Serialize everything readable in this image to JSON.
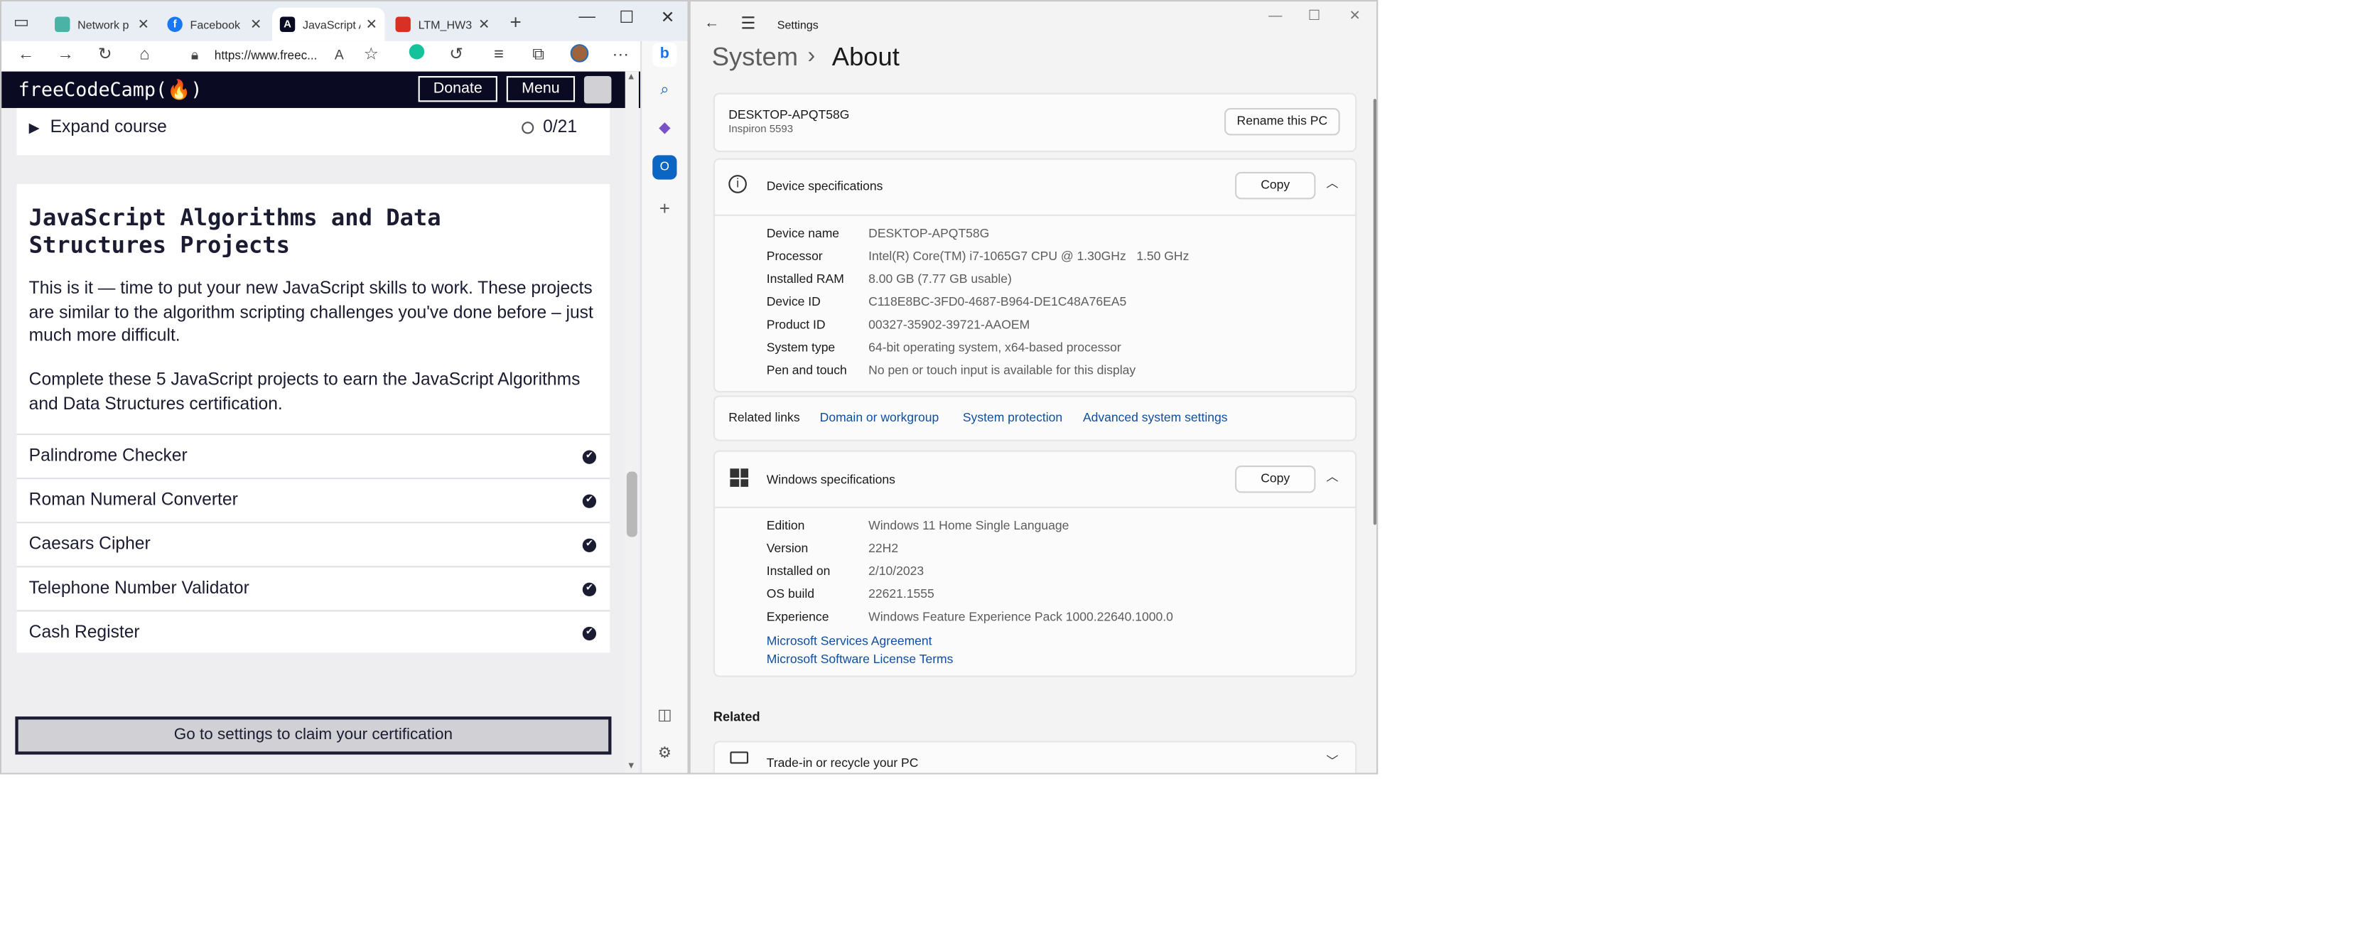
{
  "browser": {
    "tabs": [
      {
        "title": "Network p",
        "icon": "network-icon"
      },
      {
        "title": "Facebook",
        "icon": "facebook-icon"
      },
      {
        "title": "JavaScript A",
        "icon": "freecodecamp-icon"
      },
      {
        "title": "LTM_HW3",
        "icon": "pdf-icon"
      }
    ],
    "url": "https://www.freec...",
    "fcc": {
      "logo": "freeCodeCamp(🔥)",
      "donate": "Donate",
      "menu": "Menu",
      "expand_label": "Expand course",
      "expand_count": "0/21",
      "project_title": "JavaScript Algorithms and Data Structures Projects",
      "description_1": "This is it — time to put your new JavaScript skills to work. These projects are similar to the algorithm scripting challenges you've done before – just much more difficult.",
      "description_2": "Complete these 5 JavaScript projects to earn the JavaScript Algorithms and Data Structures certification.",
      "projects": [
        "Palindrome Checker",
        "Roman Numeral Converter",
        "Caesars Cipher",
        "Telephone Number Validator",
        "Cash Register"
      ],
      "claim_button": "Go to settings to claim your certification"
    }
  },
  "settings": {
    "window_title": "Settings",
    "breadcrumb_parent": "System",
    "breadcrumb_sep": "›",
    "breadcrumb_current": "About",
    "pc_name": "DESKTOP-APQT58G",
    "pc_model": "Inspiron 5593",
    "rename_button": "Rename this PC",
    "device_specs": {
      "title": "Device specifications",
      "copy": "Copy",
      "rows": [
        {
          "label": "Device name",
          "value": "DESKTOP-APQT58G"
        },
        {
          "label": "Processor",
          "value": "Intel(R) Core(TM) i7-1065G7 CPU @ 1.30GHz   1.50 GHz"
        },
        {
          "label": "Installed RAM",
          "value": "8.00 GB (7.77 GB usable)"
        },
        {
          "label": "Device ID",
          "value": "C118E8BC-3FD0-4687-B964-DE1C48A76EA5"
        },
        {
          "label": "Product ID",
          "value": "00327-35902-39721-AAOEM"
        },
        {
          "label": "System type",
          "value": "64-bit operating system, x64-based processor"
        },
        {
          "label": "Pen and touch",
          "value": "No pen or touch input is available for this display"
        }
      ]
    },
    "related_links": {
      "label": "Related links",
      "links": [
        "Domain or workgroup",
        "System protection",
        "Advanced system settings"
      ]
    },
    "windows_specs": {
      "title": "Windows specifications",
      "copy": "Copy",
      "rows": [
        {
          "label": "Edition",
          "value": "Windows 11 Home Single Language"
        },
        {
          "label": "Version",
          "value": "22H2"
        },
        {
          "label": "Installed on",
          "value": "2/10/2023"
        },
        {
          "label": "OS build",
          "value": "22621.1555"
        },
        {
          "label": "Experience",
          "value": "Windows Feature Experience Pack 1000.22640.1000.0"
        }
      ],
      "links": [
        "Microsoft Services Agreement",
        "Microsoft Software License Terms"
      ]
    },
    "related_header": "Related",
    "trade_in": "Trade-in or recycle your PC"
  }
}
